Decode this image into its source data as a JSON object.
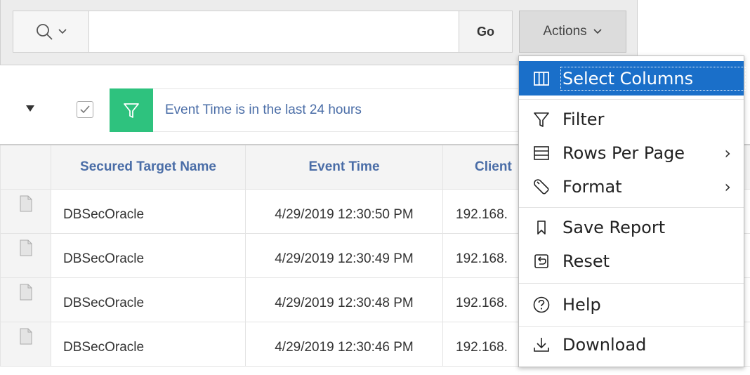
{
  "toolbar": {
    "search_value": "",
    "go_label": "Go",
    "actions_label": "Actions"
  },
  "filter": {
    "text": "Event Time is in the last 24 hours",
    "enabled": true,
    "badge_color": "#2ec27e"
  },
  "table": {
    "headers": [
      "Secured Target Name",
      "Event Time",
      "Client"
    ],
    "rows": [
      {
        "name": "DBSecOracle",
        "time": "4/29/2019 12:30:50 PM",
        "client": "192.168."
      },
      {
        "name": "DBSecOracle",
        "time": "4/29/2019 12:30:49 PM",
        "client": "192.168."
      },
      {
        "name": "DBSecOracle",
        "time": "4/29/2019 12:30:48 PM",
        "client": "192.168."
      },
      {
        "name": "DBSecOracle",
        "time": "4/29/2019 12:30:46 PM",
        "client": "192.168."
      }
    ]
  },
  "actions_menu": {
    "items": [
      {
        "label": "Select Columns",
        "icon": "columns-icon",
        "submenu": false,
        "active": true
      },
      {
        "label": "Filter",
        "icon": "filter-icon",
        "submenu": false
      },
      {
        "label": "Rows Per Page",
        "icon": "rows-icon",
        "submenu": true
      },
      {
        "label": "Format",
        "icon": "wrench-icon",
        "submenu": true
      },
      {
        "label": "Save Report",
        "icon": "bookmark-icon",
        "submenu": false
      },
      {
        "label": "Reset",
        "icon": "reset-icon",
        "submenu": false
      },
      {
        "label": "Help",
        "icon": "help-icon",
        "submenu": false
      },
      {
        "label": "Download",
        "icon": "download-icon",
        "submenu": false
      }
    ],
    "highlight_color": "#1a6fc9"
  },
  "colors": {
    "link_blue": "#4a6da7",
    "toolbar_bg": "#ececec"
  }
}
